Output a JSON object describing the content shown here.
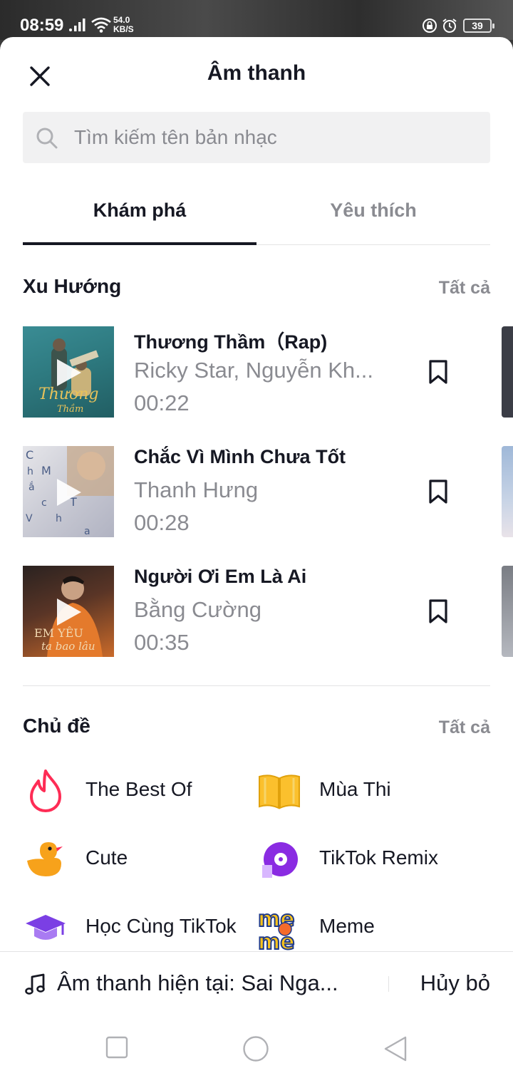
{
  "status_bar": {
    "time": "08:59",
    "speed_value": "54.0",
    "speed_unit": "KB/S",
    "battery": "39"
  },
  "header": {
    "title": "Âm thanh"
  },
  "search": {
    "placeholder": "Tìm kiếm tên bản nhạc",
    "value": ""
  },
  "tabs": [
    {
      "label": "Khám phá",
      "active": true
    },
    {
      "label": "Yêu thích",
      "active": false
    }
  ],
  "trending": {
    "title": "Xu Hướng",
    "see_all": "Tất cả",
    "tracks": [
      {
        "title": "Thương Thầm（Rap)",
        "artist": "Ricky Star, Nguyễn Kh...",
        "duration": "00:22"
      },
      {
        "title": "Chắc Vì Mình Chưa Tốt",
        "artist": "Thanh Hưng",
        "duration": "00:28"
      },
      {
        "title": "Người Ơi Em Là Ai",
        "artist": "Bằng Cường",
        "duration": "00:35"
      }
    ]
  },
  "topics": {
    "title": "Chủ đề",
    "see_all": "Tất cả",
    "items": [
      {
        "label": "The Best Of",
        "icon": "flame-icon"
      },
      {
        "label": "Mùa Thi",
        "icon": "book-icon"
      },
      {
        "label": "Cute",
        "icon": "duck-icon"
      },
      {
        "label": "TikTok Remix",
        "icon": "vinyl-icon"
      },
      {
        "label": "Học Cùng TikTok",
        "icon": "graduation-cap-icon"
      },
      {
        "label": "Meme",
        "icon": "meme-icon"
      }
    ]
  },
  "bottom_bar": {
    "current_sound": "Âm thanh hiện tại: Sai Nga...",
    "cancel": "Hủy bỏ"
  },
  "colors": {
    "text_primary": "#161823",
    "text_secondary": "#8a8b91",
    "search_bg": "#f1f1f2"
  }
}
